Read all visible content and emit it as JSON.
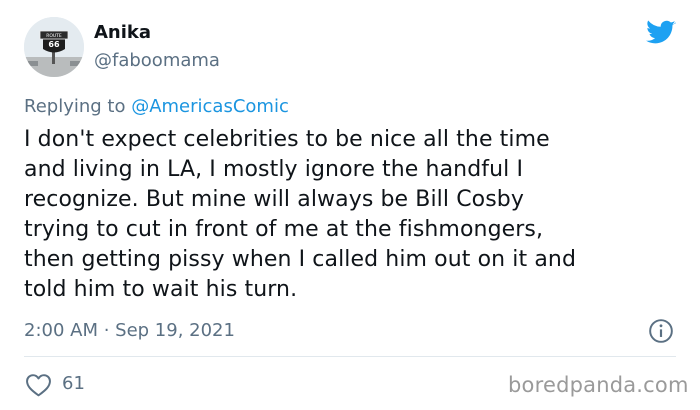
{
  "author": {
    "name": "Anika",
    "handle": "@faboomama",
    "avatar_sign_lines": [
      "ROUTE",
      "66"
    ]
  },
  "reply": {
    "prefix": "Replying to ",
    "mention": "@AmericasComic"
  },
  "tweet": {
    "lines": [
      "I don't expect celebrities to be nice all the time",
      "and living in LA, I mostly ignore the handful I",
      "recognize. But mine will always be Bill Cosby",
      "trying to cut in front of me at the fishmongers,",
      "then getting pissy when I called him out on it and",
      "told him to wait his turn."
    ]
  },
  "meta": {
    "timestamp": "2:00 AM · Sep 19, 2021",
    "likes": "61"
  },
  "watermark": "boredpanda.com",
  "icons": {
    "brand": "twitter-bird-icon",
    "info": "info-icon",
    "like": "heart-icon"
  },
  "colors": {
    "twitter_blue": "#1da1f2",
    "mention_blue": "#1b95e0",
    "secondary_text": "#5b7083",
    "primary_text": "#0f1419",
    "divider": "#e1e8ed"
  }
}
